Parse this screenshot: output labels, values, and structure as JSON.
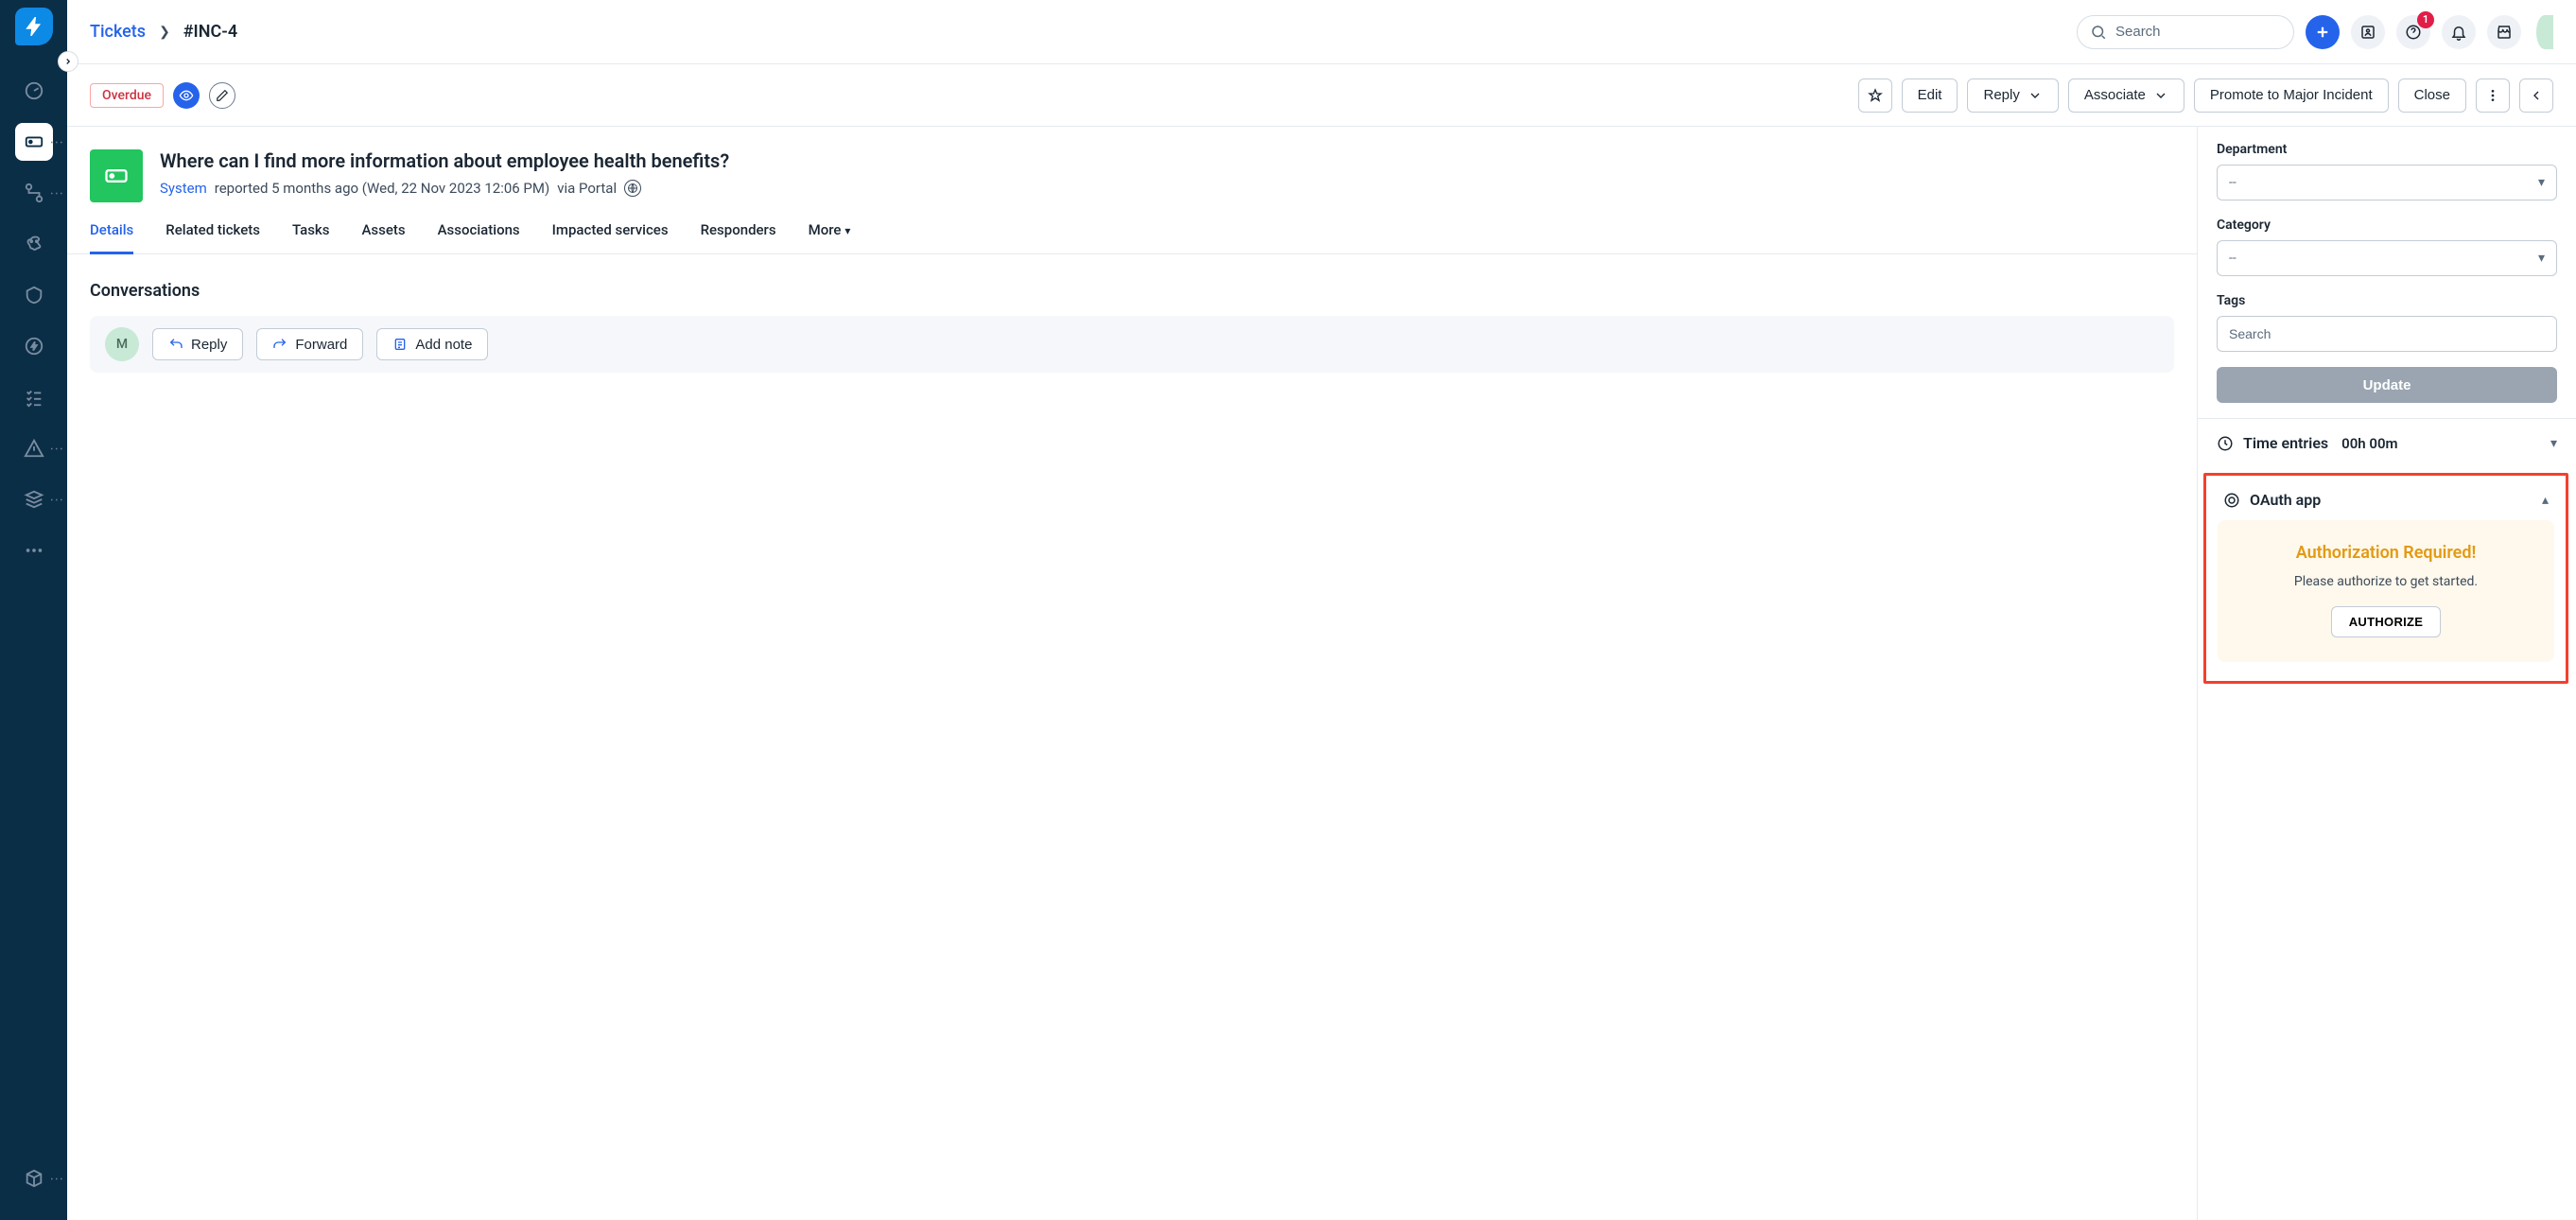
{
  "breadcrumb": {
    "root": "Tickets",
    "current": "#INC-4"
  },
  "header": {
    "search_placeholder": "Search",
    "help_badge": "1"
  },
  "actionbar": {
    "status_badge": "Overdue",
    "edit": "Edit",
    "reply": "Reply",
    "associate": "Associate",
    "promote": "Promote to Major Incident",
    "close": "Close"
  },
  "ticket": {
    "title": "Where can I find more information about employee health benefits?",
    "reporter": "System",
    "reported_prefix": "reported 5 months ago (Wed, 22 Nov 2023 12:06 PM)",
    "via": "via Portal"
  },
  "tabs": {
    "details": "Details",
    "related": "Related tickets",
    "tasks": "Tasks",
    "assets": "Assets",
    "associations": "Associations",
    "impacted": "Impacted services",
    "responders": "Responders",
    "more": "More"
  },
  "conversations": {
    "title": "Conversations",
    "avatar_initial": "M",
    "reply": "Reply",
    "forward": "Forward",
    "add_note": "Add note"
  },
  "side": {
    "department_label": "Department",
    "department_value": "--",
    "category_label": "Category",
    "category_value": "--",
    "tags_label": "Tags",
    "tags_placeholder": "Search",
    "update": "Update",
    "time_entries_label": "Time entries",
    "time_entries_value": "00h 00m",
    "oauth_title": "OAuth app",
    "oauth_required": "Authorization Required!",
    "oauth_desc": "Please authorize to get started.",
    "oauth_btn": "AUTHORIZE"
  }
}
